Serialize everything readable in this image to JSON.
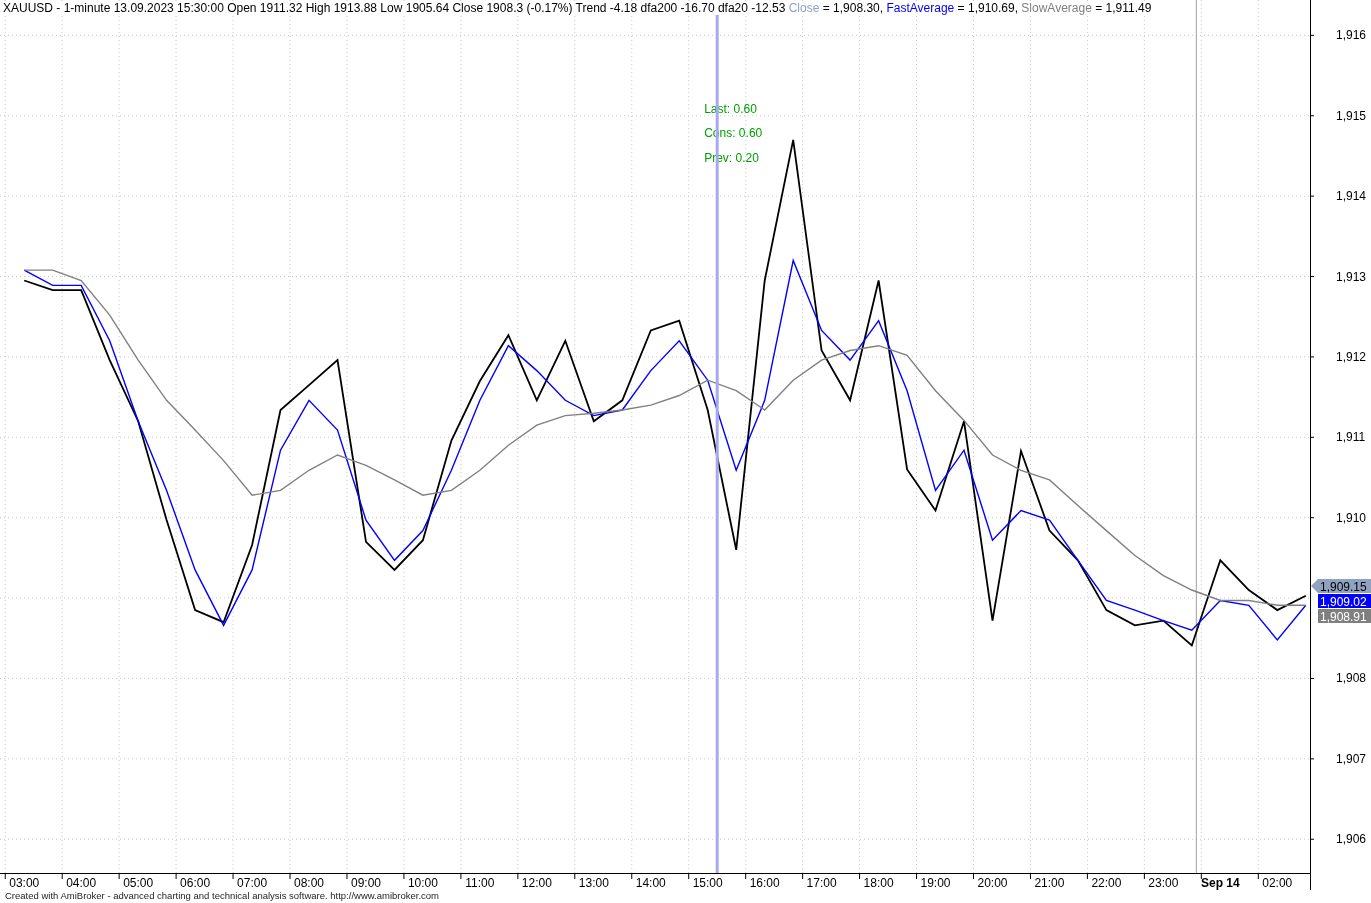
{
  "chart": {
    "title": "XAUUSD - 1-minute 13.09.2023 15:30:00 Open 1911.32 High 1913.88 Low 1905.64 Close 1908.3 (-0.17%) Trend -4.18 dfa200 -16.70 dfa20 -12.53",
    "legend": [
      {
        "name": "Close",
        "value": "= 1,908.30,",
        "color": "#8fa2c0"
      },
      {
        "value": "= 1,910.69,",
        "color": "#0000ff"
      },
      {
        "value": "= 1,911.49",
        "color": "#808080"
      }
    ],
    "study_labels": [
      "Last: 0.60",
      "Cons: 0.60",
      "Prev: 0.20"
    ],
    "value_tags": [
      {
        "text": "1,909.15",
        "color": "#8fa2c0"
      },
      {
        "text": "1,909.02",
        "color": "#0000ff"
      },
      {
        "text": "1,908.91",
        "color": "#808080"
      }
    ],
    "chart_data": {
      "type": "line",
      "categories": [
        "03:00",
        null,
        "04:00",
        null,
        "05:00",
        null,
        "06:00",
        null,
        "07:00",
        null,
        "08:00",
        null,
        "09:00",
        null,
        "10:00",
        null,
        "11:00",
        null,
        "12:00",
        null,
        "13:00",
        null,
        "14:00",
        null,
        "15:00",
        null,
        "16:00",
        null,
        "17:00",
        null,
        "18:00",
        null,
        "19:00",
        null,
        "20:00",
        null,
        "21:00",
        null,
        "22:00",
        null,
        "23:00",
        null,
        "Sep 14",
        null,
        "02:00",
        null
      ],
      "series": [
        {
          "color": "#000000",
          "values": [
            1912.95,
            1912.83,
            1912.83,
            1911.96,
            1911.2,
            1909.97,
            1908.85,
            1908.7,
            1909.66,
            1911.34,
            1911.65,
            1911.96,
            1909.7,
            1909.35,
            1909.72,
            1910.96,
            1911.7,
            1912.27,
            1911.46,
            1912.2,
            1911.2,
            1911.46,
            1912.33,
            1912.45,
            1911.34,
            1909.6,
            1912.95,
            1914.7,
            1912.08,
            1911.46,
            1912.95,
            1910.6,
            1910.09,
            1911.2,
            1908.72,
            1910.83,
            1909.84,
            1909.47,
            1908.85,
            1908.66,
            1908.72,
            1908.41,
            1909.47,
            1909.1,
            1908.85,
            1909.03
          ]
        },
        {
          "name": "FastAverage",
          "color": "#0000ff",
          "values": [
            1913.08,
            1912.89,
            1912.89,
            1912.2,
            1911.2,
            1910.34,
            1909.35,
            1908.66,
            1909.35,
            1910.84,
            1911.46,
            1911.09,
            1909.97,
            1909.47,
            1909.84,
            1910.59,
            1911.46,
            1912.14,
            1911.83,
            1911.46,
            1911.27,
            1911.34,
            1911.83,
            1912.2,
            1911.71,
            1910.59,
            1911.46,
            1913.2,
            1912.33,
            1911.96,
            1912.45,
            1911.58,
            1910.34,
            1910.84,
            1909.72,
            1910.09,
            1909.97,
            1909.47,
            1908.97,
            1908.85,
            1908.72,
            1908.6,
            1908.97,
            1908.91,
            1908.48,
            1908.91
          ]
        },
        {
          "name": "SlowAverage",
          "color": "#808080",
          "values": [
            1913.08,
            1913.08,
            1912.95,
            1912.52,
            1911.96,
            1911.46,
            1911.09,
            1910.71,
            1910.28,
            1910.34,
            1910.59,
            1910.78,
            1910.65,
            1910.47,
            1910.28,
            1910.34,
            1910.59,
            1910.9,
            1911.15,
            1911.27,
            1911.3,
            1911.34,
            1911.4,
            1911.52,
            1911.71,
            1911.58,
            1911.34,
            1911.71,
            1911.96,
            1912.08,
            1912.14,
            1912.02,
            1911.58,
            1911.21,
            1910.78,
            1910.59,
            1910.47,
            1910.15,
            1909.84,
            1909.53,
            1909.28,
            1909.1,
            1908.97,
            1908.97,
            1908.91,
            1908.91
          ]
        }
      ],
      "ylim": [
        1905.58,
        1916.44
      ],
      "grid": true,
      "yticks": [
        {
          "value": 1906,
          "label": "1,906"
        },
        {
          "value": 1907,
          "label": "1,907"
        },
        {
          "value": 1908,
          "label": "1,908"
        },
        {
          "value": 1910,
          "label": "1,910"
        },
        {
          "value": 1911,
          "label": "1,911"
        },
        {
          "value": 1912,
          "label": "1,912"
        },
        {
          "value": 1913,
          "label": "1,913"
        },
        {
          "value": 1914,
          "label": "1,914"
        },
        {
          "value": 1915,
          "label": "1,915"
        },
        {
          "value": 1916,
          "label": "1,916"
        }
      ]
    }
  },
  "footer": "Created with AmiBroker - advanced charting and technical analysis software. http://www.amibroker.com"
}
